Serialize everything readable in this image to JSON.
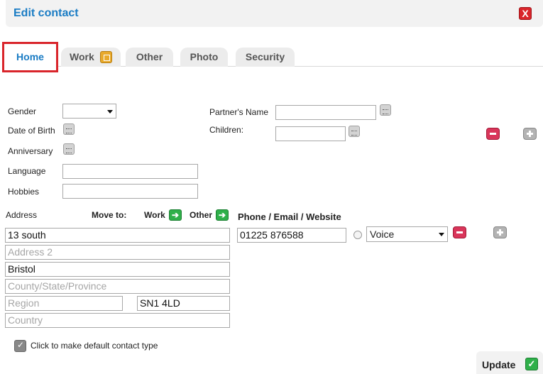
{
  "dialog": {
    "title": "Edit contact",
    "close_glyph": "X"
  },
  "tabs": [
    {
      "label": "Home",
      "active": true
    },
    {
      "label": "Work"
    },
    {
      "label": "Other"
    },
    {
      "label": "Photo"
    },
    {
      "label": "Security"
    }
  ],
  "personal": {
    "gender_label": "Gender",
    "gender_value": "",
    "dob_label": "Date of Birth",
    "anniversary_label": "Anniversary",
    "language_label": "Language",
    "language_value": "",
    "hobbies_label": "Hobbies",
    "hobbies_value": "",
    "partner_label": "Partner's Name",
    "partner_value": "",
    "children_label": "Children:",
    "children_value": ""
  },
  "address": {
    "label": "Address",
    "move_to_label": "Move to:",
    "move_work_label": "Work",
    "move_other_label": "Other",
    "arrow_glyph": "➔",
    "line1": "13 south",
    "line2_placeholder": "Address 2",
    "city": "Bristol",
    "county_placeholder": "County/State/Province",
    "region_placeholder": "Region",
    "postcode": "SN1 4LD",
    "country_placeholder": "Country"
  },
  "contact": {
    "heading": "Phone / Email / Website",
    "value": "01225 876588",
    "type": "Voice"
  },
  "default_toggle_label": "Click to make default contact type",
  "update": {
    "label": "Update",
    "glyph": "✓"
  },
  "colors": {
    "accent": "#1a7cc4",
    "active_tab_border": "#d9252b",
    "remove": "#d9355a",
    "go": "#2fb04a"
  }
}
